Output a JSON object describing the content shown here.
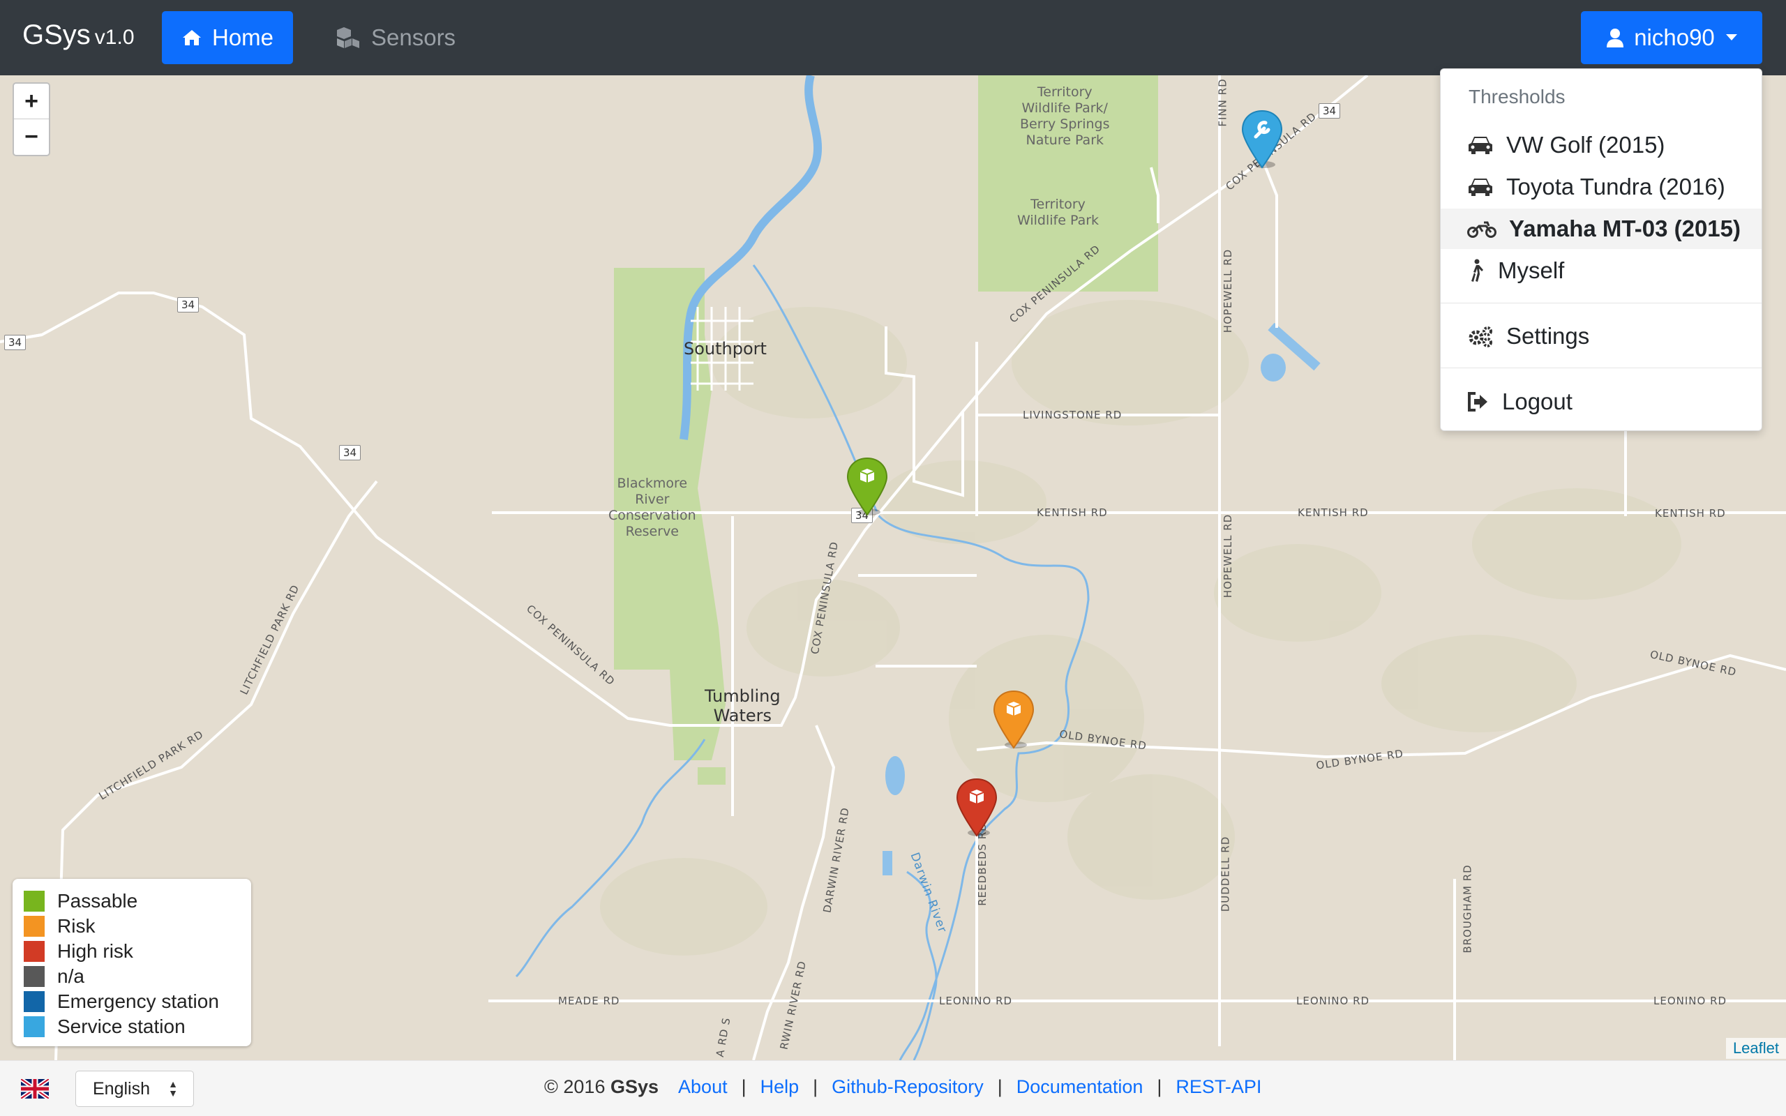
{
  "navbar": {
    "brand": "GSys",
    "version": "v1.0",
    "home_label": "Home",
    "sensors_label": "Sensors",
    "user_label": "nicho90"
  },
  "map": {
    "zoom_in": "+",
    "zoom_out": "−",
    "attribution": "Leaflet",
    "places": {
      "southport": "Southport",
      "tumbling_1": "Tumbling",
      "tumbling_2": "Waters",
      "blackmore_1": "Blackmore",
      "blackmore_2": "River",
      "blackmore_3": "Conservation",
      "blackmore_4": "Reserve",
      "twp_1": "Territory",
      "twp_2": "Wildlife Park/",
      "twp_3": "Berry Springs",
      "twp_4": "Nature Park",
      "tw_1": "Territory",
      "tw_2": "Wildlife Park"
    },
    "roads": {
      "cox1": "COX PENINSULA RD",
      "cox2": "COX PENINSULA RD",
      "cox3": "COX PENINSULA RD",
      "cox4": "COX PENINSULA RD",
      "litchfield1": "LITCHFIELD PARK RD",
      "litchfield2": "LITCHFIELD PARK RD",
      "livingstone": "LIVINGSTONE RD",
      "kentish1": "KENTISH RD",
      "kentish2": "KENTISH RD",
      "kentish3": "KENTISH RD",
      "oldbynoe1": "OLD BYNOE RD",
      "oldbynoe2": "OLD BYNOE RD",
      "oldbynoe3": "OLD BYNOE RD",
      "hopewell1": "HOPEWELL RD",
      "hopewell2": "HOPEWELL RD",
      "finn": "FINN RD",
      "duddell": "DUDDELL RD",
      "brougham": "BROUGHAM RD",
      "reedbeds": "REEDBEDS RD",
      "darwin1": "DARWIN RIVER RD",
      "darwin2": "RWIN RIVER RD",
      "ards": "A RD S",
      "meade": "MEADE RD",
      "leonino1": "LEONINO RD",
      "leonino2": "LEONINO RD",
      "leonino3": "LEONINO RD",
      "darwin_river": "Darwin River",
      "shield34": "34"
    }
  },
  "legend": [
    {
      "label": "Passable",
      "color": "#78b51e"
    },
    {
      "label": "Risk",
      "color": "#f39422"
    },
    {
      "label": "High risk",
      "color": "#d23b25"
    },
    {
      "label": "n/a",
      "color": "#585858"
    },
    {
      "label": "Emergency station",
      "color": "#1266a8"
    },
    {
      "label": "Service station",
      "color": "#38a7e0"
    }
  ],
  "dropdown": {
    "header": "Thresholds",
    "items": [
      "VW Golf (2015)",
      "Toyota Tundra (2016)",
      "Yamaha MT-03 (2015)",
      "Myself"
    ],
    "settings": "Settings",
    "logout": "Logout"
  },
  "footer": {
    "language": "English",
    "copyright": "© 2016",
    "brand": "GSys",
    "links": [
      "About",
      "Help",
      "Github-Repository",
      "Documentation",
      "REST-API"
    ]
  }
}
